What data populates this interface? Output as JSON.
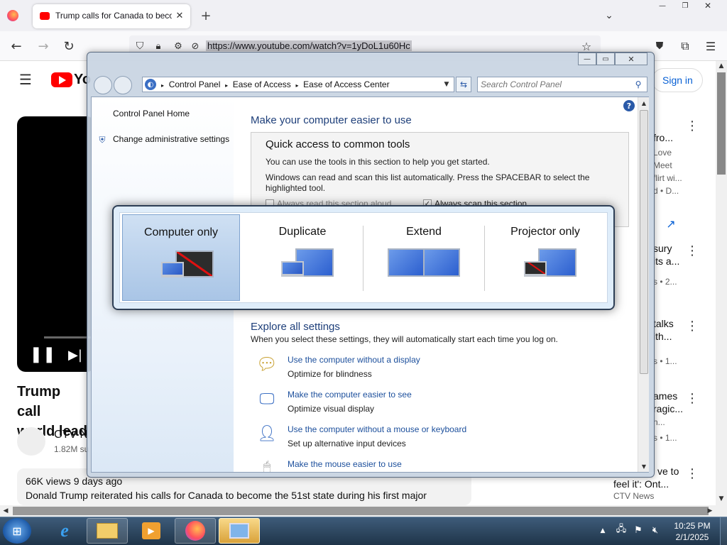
{
  "browser": {
    "tab_title": "Trump calls for Canada to beco",
    "url": "https://www.youtube.com/watch?v=1yDoL1u60Hc"
  },
  "youtube": {
    "sign_in": "Sign in",
    "video_title_line1": "Trump call",
    "video_title_line2": "world lead",
    "channel_name": "CTV N",
    "subscribers": "1.82M su",
    "views_date": "66K views  9 days ago",
    "description": "Donald Trump reiterated his calls for Canada to become the 51st state during his first major",
    "sidebar": [
      {
        "title": "fro...",
        "meta": [
          "Love",
          "Meet",
          "flirt wi...",
          "d • D..."
        ]
      },
      {
        "title": "sury",
        "meta": [
          "its a...",
          "s • 2..."
        ]
      },
      {
        "title": "talks",
        "meta": [
          "ith...",
          "s • 1..."
        ]
      },
      {
        "title": "ames",
        "meta": [
          "ragic...",
          "n...",
          "s • 1..."
        ]
      },
      {
        "title": "ve to",
        "meta": [
          "feel it': Ont...",
          "CTV News"
        ]
      }
    ]
  },
  "control_panel": {
    "breadcrumb": [
      "Control Panel",
      "Ease of Access",
      "Ease of Access Center"
    ],
    "search_placeholder": "Search Control Panel",
    "left_links": [
      "Control Panel Home",
      "Change administrative settings"
    ],
    "heading": "Make your computer easier to use",
    "quick_access_title": "Quick access to common tools",
    "quick_access_text1": "You can use the tools in this section to help you get started.",
    "quick_access_text2": "Windows can read and scan this list automatically.  Press the SPACEBAR to select the highlighted tool.",
    "check_read": "Always read this section aloud",
    "check_scan": "Always scan this section",
    "explore_title": "Explore all settings",
    "explore_text": "When you select these settings, they will automatically start each time you log on.",
    "settings": [
      {
        "link": "Use the computer without a display",
        "desc": "Optimize for blindness"
      },
      {
        "link": "Make the computer easier to see",
        "desc": "Optimize visual display"
      },
      {
        "link": "Use the computer without a mouse or keyboard",
        "desc": "Set up alternative input devices"
      },
      {
        "link": "Make the mouse easier to use",
        "desc": ""
      }
    ]
  },
  "display_switcher": {
    "options": [
      "Computer only",
      "Duplicate",
      "Extend",
      "Projector only"
    ],
    "selected": "Computer only"
  },
  "taskbar": {
    "time": "10:25 PM",
    "date": "2/1/2025"
  },
  "colors": {
    "youtube_red": "#ff0000",
    "link_blue": "#1c4f9c",
    "switcher_selected": "#b9d1ec"
  }
}
